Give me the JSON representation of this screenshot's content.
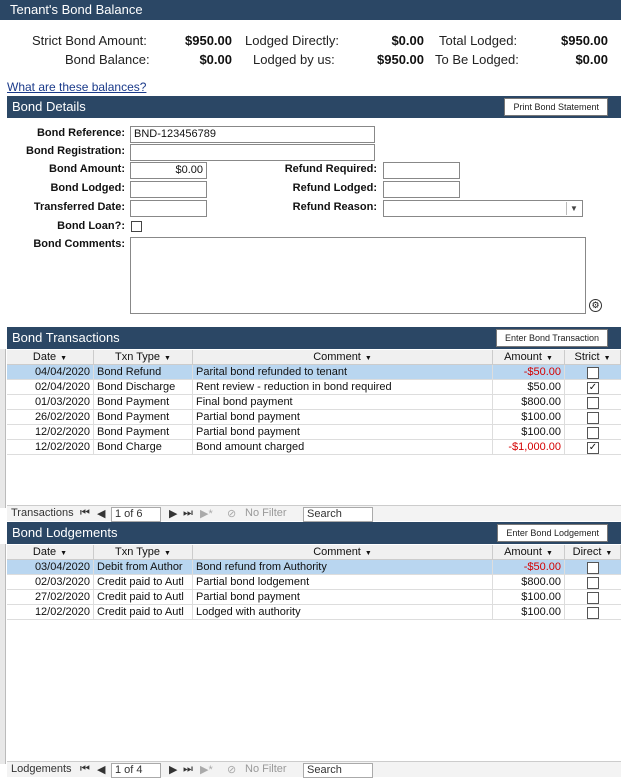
{
  "window_title": "Tenant's Bond Balance",
  "summary": {
    "strict_bond_amount_label": "Strict Bond Amount:",
    "strict_bond_amount": "$950.00",
    "bond_balance_label": "Bond Balance:",
    "bond_balance": "$0.00",
    "lodged_directly_label": "Lodged Directly:",
    "lodged_directly": "$0.00",
    "lodged_by_us_label": "Lodged by us:",
    "lodged_by_us": "$950.00",
    "total_lodged_label": "Total Lodged:",
    "total_lodged": "$950.00",
    "to_be_lodged_label": "To Be Lodged:",
    "to_be_lodged": "$0.00"
  },
  "help_link": "What are these balances?",
  "bond_details": {
    "title": "Bond Details",
    "print_button": "Print Bond Statement",
    "labels": {
      "reference": "Bond Reference:",
      "registration": "Bond Registration:",
      "amount": "Bond Amount:",
      "lodged": "Bond Lodged:",
      "transferred": "Transferred Date:",
      "loan": "Bond Loan?:",
      "comments": "Bond Comments:",
      "refund_required": "Refund Required:",
      "refund_lodged": "Refund Lodged:",
      "refund_reason": "Refund Reason:"
    },
    "values": {
      "reference": "BND-123456789",
      "registration": "",
      "amount": "$0.00",
      "lodged": "",
      "transferred": "",
      "comments": "",
      "refund_required": "",
      "refund_lodged": "",
      "refund_reason": ""
    },
    "bond_loan_checked": false
  },
  "transactions": {
    "title": "Bond Transactions",
    "enter_button": "Enter Bond Transaction",
    "columns": [
      "Date",
      "Txn Type",
      "Comment",
      "Amount",
      "Strict"
    ],
    "rows": [
      {
        "date": "04/04/2020",
        "type": "Bond Refund",
        "comment": "Parital bond refunded to tenant",
        "amount": "-$50.00",
        "strict": false
      },
      {
        "date": "02/04/2020",
        "type": "Bond Discharge",
        "comment": "Rent review - reduction in bond required",
        "amount": "$50.00",
        "strict": true
      },
      {
        "date": "01/03/2020",
        "type": "Bond Payment",
        "comment": "Final bond payment",
        "amount": "$800.00",
        "strict": false
      },
      {
        "date": "26/02/2020",
        "type": "Bond Payment",
        "comment": "Partial bond payment",
        "amount": "$100.00",
        "strict": false
      },
      {
        "date": "12/02/2020",
        "type": "Bond Payment",
        "comment": "Partial bond payment",
        "amount": "$100.00",
        "strict": false
      },
      {
        "date": "12/02/2020",
        "type": "Bond Charge",
        "comment": "Bond amount charged",
        "amount": "-$1,000.00",
        "strict": true
      }
    ],
    "nav": {
      "label": "Transactions",
      "record": "1 of 6",
      "filter": "No Filter",
      "search": "Search"
    }
  },
  "lodgements": {
    "title": "Bond Lodgements",
    "enter_button": "Enter Bond Lodgement",
    "columns": [
      "Date",
      "Txn Type",
      "Comment",
      "Amount",
      "Direct"
    ],
    "rows": [
      {
        "date": "03/04/2020",
        "type": "Debit from Author",
        "comment": "Bond refund from Authority",
        "amount": "-$50.00",
        "direct": false
      },
      {
        "date": "02/03/2020",
        "type": "Credit paid to Autl",
        "comment": "Partial bond lodgement",
        "amount": "$800.00",
        "direct": false
      },
      {
        "date": "27/02/2020",
        "type": "Credit paid to Autl",
        "comment": "Partial bond payment",
        "amount": "$100.00",
        "direct": false
      },
      {
        "date": "12/02/2020",
        "type": "Credit paid to Autl",
        "comment": "Lodged with authority",
        "amount": "$100.00",
        "direct": false
      }
    ],
    "nav": {
      "label": "Lodgements",
      "record": "1 of 4",
      "filter": "No Filter",
      "search": "Search"
    }
  },
  "icons": {
    "sort": "chevron-down-icon",
    "first": "first-record-icon",
    "prev": "prev-record-icon",
    "next": "next-record-icon",
    "last": "last-record-icon",
    "new": "new-record-icon",
    "filter": "filter-icon",
    "dropdown": "chevron-down-icon"
  },
  "colors": {
    "header": "#2b4765",
    "selected_row": "#b9d6f0",
    "negative": "#d40000"
  }
}
